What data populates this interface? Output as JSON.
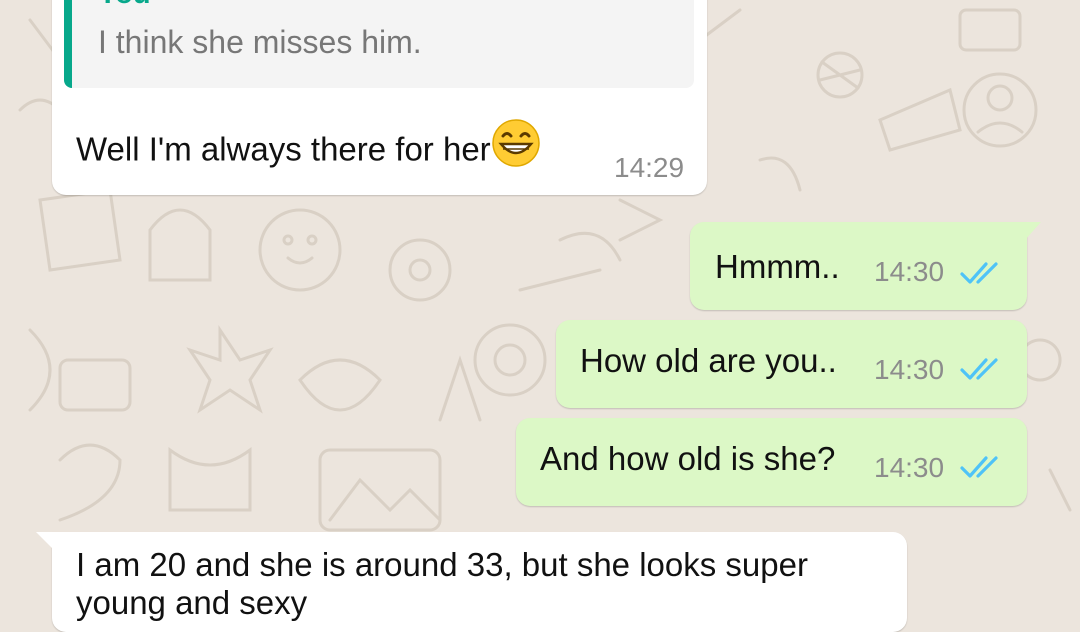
{
  "colors": {
    "outgoing_bubble": "#dcf8c6",
    "incoming_bubble": "#ffffff",
    "quote_accent": "#07a88b",
    "read_ticks": "#4fc3f7",
    "wallpaper": "#ece5dd",
    "timestamp": "#8c8c8c"
  },
  "messages": [
    {
      "direction": "incoming",
      "quoted": {
        "author": "You",
        "text": "I think she misses him."
      },
      "text": "Well I'm always there for her",
      "emoji": "grinning-face-with-smiling-eyes",
      "time": "14:29"
    },
    {
      "direction": "outgoing",
      "text": "Hmmm..",
      "time": "14:30",
      "status": "read"
    },
    {
      "direction": "outgoing",
      "text": "How old are you..",
      "time": "14:30",
      "status": "read"
    },
    {
      "direction": "outgoing",
      "text": "And how old is she?",
      "time": "14:30",
      "status": "read"
    },
    {
      "direction": "incoming",
      "text": "I am 20 and she is around 33, but she looks super",
      "text_line2": "young and sexy"
    }
  ]
}
